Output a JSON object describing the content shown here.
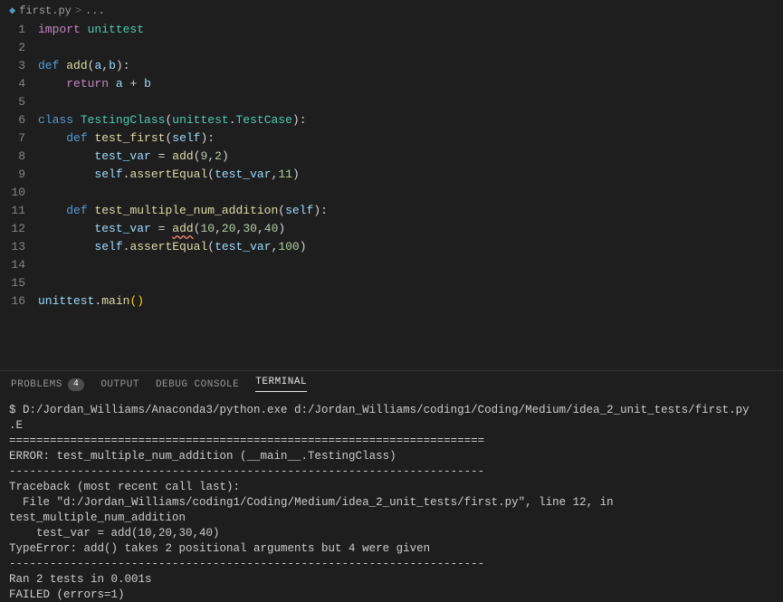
{
  "breadcrumb": {
    "file": "first.py",
    "separator": ">",
    "trail": "..."
  },
  "editor": {
    "lines": [
      {
        "n": 1,
        "tokens": [
          [
            "tk-keyword",
            "import"
          ],
          [
            "",
            " "
          ],
          [
            "tk-module",
            "unittest"
          ]
        ]
      },
      {
        "n": 2,
        "tokens": []
      },
      {
        "n": 3,
        "tokens": [
          [
            "tk-def",
            "def"
          ],
          [
            "",
            " "
          ],
          [
            "tk-fn",
            "add"
          ],
          [
            "tk-punct",
            "("
          ],
          [
            "tk-param",
            "a"
          ],
          [
            "tk-punct",
            ","
          ],
          [
            "tk-param",
            "b"
          ],
          [
            "tk-punct",
            ")"
          ],
          [
            "tk-punct",
            ":"
          ]
        ]
      },
      {
        "n": 4,
        "tokens": [
          [
            "",
            "    "
          ],
          [
            "tk-keyword",
            "return"
          ],
          [
            "",
            " "
          ],
          [
            "tk-param",
            "a"
          ],
          [
            "",
            " "
          ],
          [
            "tk-op",
            "+"
          ],
          [
            "",
            " "
          ],
          [
            "tk-param",
            "b"
          ]
        ]
      },
      {
        "n": 5,
        "tokens": []
      },
      {
        "n": 6,
        "tokens": [
          [
            "tk-def",
            "class"
          ],
          [
            "",
            " "
          ],
          [
            "tk-class",
            "TestingClass"
          ],
          [
            "tk-punct",
            "("
          ],
          [
            "tk-class",
            "unittest"
          ],
          [
            "tk-punct",
            "."
          ],
          [
            "tk-class",
            "TestCase"
          ],
          [
            "tk-punct",
            ")"
          ],
          [
            "tk-punct",
            ":"
          ]
        ]
      },
      {
        "n": 7,
        "tokens": [
          [
            "",
            "    "
          ],
          [
            "tk-def",
            "def"
          ],
          [
            "",
            " "
          ],
          [
            "tk-fn",
            "test_first"
          ],
          [
            "tk-punct",
            "("
          ],
          [
            "tk-self",
            "self"
          ],
          [
            "tk-punct",
            ")"
          ],
          [
            "tk-punct",
            ":"
          ]
        ]
      },
      {
        "n": 8,
        "tokens": [
          [
            "",
            "        "
          ],
          [
            "tk-param",
            "test_var"
          ],
          [
            "",
            " "
          ],
          [
            "tk-op",
            "="
          ],
          [
            "",
            " "
          ],
          [
            "tk-fn",
            "add"
          ],
          [
            "tk-punct",
            "("
          ],
          [
            "tk-num",
            "9"
          ],
          [
            "tk-punct",
            ","
          ],
          [
            "tk-num",
            "2"
          ],
          [
            "tk-punct",
            ")"
          ]
        ]
      },
      {
        "n": 9,
        "tokens": [
          [
            "",
            "        "
          ],
          [
            "tk-self",
            "self"
          ],
          [
            "tk-punct",
            "."
          ],
          [
            "tk-fn",
            "assertEqual"
          ],
          [
            "tk-punct",
            "("
          ],
          [
            "tk-param",
            "test_var"
          ],
          [
            "tk-punct",
            ","
          ],
          [
            "tk-num",
            "11"
          ],
          [
            "tk-punct",
            ")"
          ]
        ]
      },
      {
        "n": 10,
        "tokens": []
      },
      {
        "n": 11,
        "tokens": [
          [
            "",
            "    "
          ],
          [
            "tk-def",
            "def"
          ],
          [
            "",
            " "
          ],
          [
            "tk-fn",
            "test_multiple_num_addition"
          ],
          [
            "tk-punct",
            "("
          ],
          [
            "tk-self",
            "self"
          ],
          [
            "tk-punct",
            ")"
          ],
          [
            "tk-punct",
            ":"
          ]
        ]
      },
      {
        "n": 12,
        "tokens": [
          [
            "",
            "        "
          ],
          [
            "tk-param",
            "test_var"
          ],
          [
            "",
            " "
          ],
          [
            "tk-op",
            "="
          ],
          [
            "",
            " "
          ],
          [
            "tk-fn squiggle",
            "add"
          ],
          [
            "tk-punct",
            "("
          ],
          [
            "tk-num",
            "10"
          ],
          [
            "tk-punct",
            ","
          ],
          [
            "tk-num",
            "20"
          ],
          [
            "tk-punct",
            ","
          ],
          [
            "tk-num",
            "30"
          ],
          [
            "tk-punct",
            ","
          ],
          [
            "tk-num",
            "40"
          ],
          [
            "tk-punct",
            ")"
          ]
        ]
      },
      {
        "n": 13,
        "tokens": [
          [
            "",
            "        "
          ],
          [
            "tk-self",
            "self"
          ],
          [
            "tk-punct",
            "."
          ],
          [
            "tk-fn",
            "assertEqual"
          ],
          [
            "tk-punct",
            "("
          ],
          [
            "tk-param",
            "test_var"
          ],
          [
            "tk-punct",
            ","
          ],
          [
            "tk-num",
            "100"
          ],
          [
            "tk-punct",
            ")"
          ]
        ]
      },
      {
        "n": 14,
        "tokens": []
      },
      {
        "n": 15,
        "tokens": []
      },
      {
        "n": 16,
        "tokens": [
          [
            "tk-param",
            "unittest"
          ],
          [
            "tk-punct",
            "."
          ],
          [
            "tk-fn",
            "main"
          ],
          [
            "tk-paren",
            "("
          ],
          [
            "tk-paren",
            ")"
          ]
        ]
      }
    ]
  },
  "panel": {
    "tabs": {
      "problems": "PROBLEMS",
      "problems_count": "4",
      "output": "OUTPUT",
      "debug": "DEBUG CONSOLE",
      "terminal": "TERMINAL"
    },
    "terminal_lines": [
      "$ D:/Jordan_Williams/Anaconda3/python.exe d:/Jordan_Williams/coding1/Coding/Medium/idea_2_unit_tests/first.py",
      ".E",
      "======================================================================",
      "ERROR: test_multiple_num_addition (__main__.TestingClass)",
      "----------------------------------------------------------------------",
      "Traceback (most recent call last):",
      "  File \"d:/Jordan_Williams/coding1/Coding/Medium/idea_2_unit_tests/first.py\", line 12, in test_multiple_num_addition",
      "    test_var = add(10,20,30,40)",
      "TypeError: add() takes 2 positional arguments but 4 were given",
      "",
      "----------------------------------------------------------------------",
      "Ran 2 tests in 0.001s",
      "",
      "FAILED (errors=1)"
    ]
  }
}
